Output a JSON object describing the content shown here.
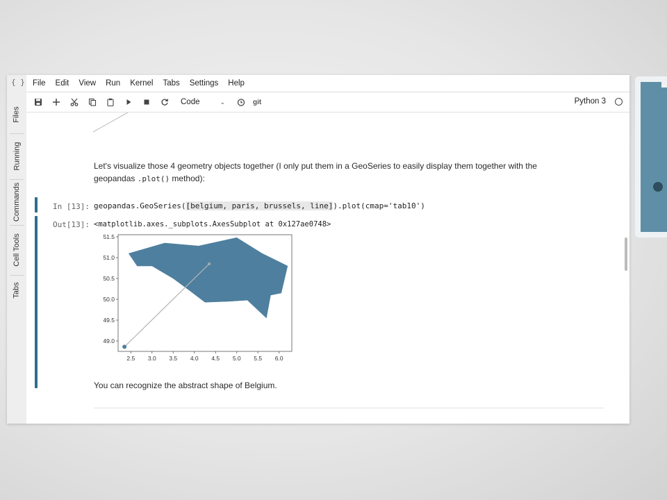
{
  "app": {
    "logo": "{ }"
  },
  "sidebar": {
    "tabs": [
      {
        "label": "Files"
      },
      {
        "label": "Running"
      },
      {
        "label": "Commands"
      },
      {
        "label": "Cell Tools"
      },
      {
        "label": "Tabs"
      }
    ]
  },
  "menu": {
    "items": [
      {
        "label": "File"
      },
      {
        "label": "Edit"
      },
      {
        "label": "View"
      },
      {
        "label": "Run"
      },
      {
        "label": "Kernel"
      },
      {
        "label": "Tabs"
      },
      {
        "label": "Settings"
      },
      {
        "label": "Help"
      }
    ]
  },
  "toolbar": {
    "icons": [
      "save-icon",
      "add-icon",
      "cut-icon",
      "copy-icon",
      "paste-icon",
      "run-icon",
      "stop-icon",
      "restart-icon"
    ],
    "cell_type": "Code",
    "git_label": "git",
    "kernel_name": "Python 3"
  },
  "cells": {
    "md1": {
      "before_code": "Let's visualize those 4 geometry objects together (I only put them in a GeoSeries to easily display them together with the geopandas ",
      "code": ".plot()",
      "after_code": " method):"
    },
    "code1": {
      "prompt": "In [13]:",
      "prefix": "geopandas.GeoSeries(",
      "highlight": "[belgium, paris, brussels, line]",
      "suffix": ").plot(cmap='tab10')"
    },
    "out1": {
      "prompt": "Out[13]:",
      "text": "<matplotlib.axes._subplots.AxesSubplot at 0x127ae0748>"
    },
    "md2": {
      "text": "You can recognize the abstract shape of Belgium."
    },
    "md3_cutoff": {
      "text": ""
    }
  },
  "chart_data": {
    "type": "geo",
    "xlim": [
      2.2,
      6.3
    ],
    "ylim": [
      48.75,
      51.55
    ],
    "xticks": [
      "2.5",
      "3.0",
      "3.5",
      "4.0",
      "4.5",
      "5.0",
      "5.5",
      "6.0"
    ],
    "yticks": [
      "49.0",
      "49.5",
      "50.0",
      "50.5",
      "51.0",
      "51.5"
    ],
    "colors": {
      "polygon": "#4e7f9e",
      "line": "#b5b5b5",
      "point": "#4e7f9e"
    },
    "polygon_belgium": [
      [
        2.45,
        51.1
      ],
      [
        3.3,
        51.35
      ],
      [
        4.1,
        51.28
      ],
      [
        5.0,
        51.48
      ],
      [
        5.6,
        51.1
      ],
      [
        6.2,
        50.8
      ],
      [
        6.05,
        50.15
      ],
      [
        5.8,
        50.1
      ],
      [
        5.7,
        49.55
      ],
      [
        5.25,
        49.98
      ],
      [
        4.8,
        49.95
      ],
      [
        4.25,
        49.93
      ],
      [
        3.9,
        50.2
      ],
      [
        3.5,
        50.5
      ],
      [
        3.0,
        50.8
      ],
      [
        2.65,
        50.8
      ]
    ],
    "point_paris": [
      2.35,
      48.86
    ],
    "point_brussels": [
      4.35,
      50.85
    ],
    "line": [
      [
        2.35,
        48.86
      ],
      [
        4.35,
        50.85
      ]
    ]
  }
}
